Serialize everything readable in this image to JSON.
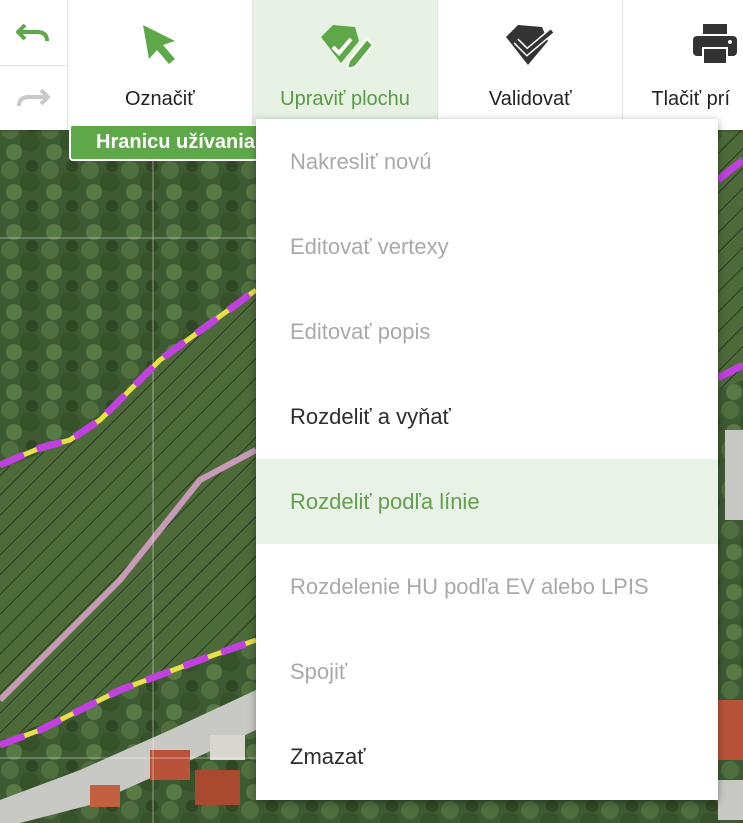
{
  "toolbar": {
    "undo_icon": "undo-icon",
    "redo_icon": "redo-icon",
    "tools": [
      {
        "label": "Označiť",
        "icon": "cursor-arrow-icon",
        "active": false
      },
      {
        "label": "Upraviť plochu",
        "icon": "edit-polygon-icon",
        "active": true
      },
      {
        "label": "Validovať",
        "icon": "validate-polygon-icon",
        "active": false
      },
      {
        "label": "Tlačiť prí",
        "icon": "printer-icon",
        "active": false
      }
    ]
  },
  "mode_badge": {
    "label": "Hranicu užívania"
  },
  "dropdown": {
    "items": [
      {
        "label": "Nakresliť novú",
        "state": "disabled"
      },
      {
        "label": "Editovať vertexy",
        "state": "disabled"
      },
      {
        "label": "Editovať popis",
        "state": "disabled"
      },
      {
        "label": "Rozdeliť a vyňať",
        "state": "enabled"
      },
      {
        "label": "Rozdeliť podľa línie",
        "state": "highlighted"
      },
      {
        "label": "Rozdelenie HU podľa EV alebo LPIS",
        "state": "disabled"
      },
      {
        "label": "Spojiť",
        "state": "disabled"
      },
      {
        "label": "Zmazať",
        "state": "enabled"
      }
    ]
  },
  "colors": {
    "accent_green": "#5fa84a",
    "highlight_bg": "#e9f2e6",
    "boundary_magenta": "#c23fe0",
    "boundary_yellow": "#e7e04a"
  }
}
